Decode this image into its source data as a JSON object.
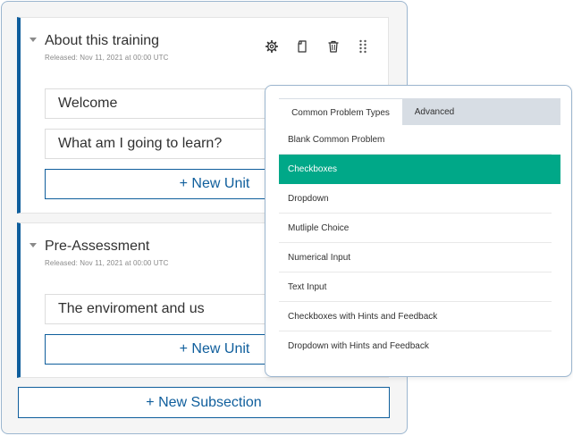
{
  "subsections": [
    {
      "title": "About this training",
      "meta": "Released: Nov 11, 2021 at 00:00 UTC",
      "units": [
        "Welcome",
        "What am I going to learn?"
      ],
      "new_unit_label": "+ New Unit"
    },
    {
      "title": "Pre-Assessment",
      "meta": "Released: Nov 11, 2021 at 00:00 UTC",
      "units": [
        "The enviroment and us"
      ],
      "new_unit_label": "+ New Unit"
    }
  ],
  "new_subsection_label": "+ New Subsection",
  "actions": {
    "icons": [
      "gear-icon",
      "document-icon",
      "trash-icon",
      "drag-handle-icon"
    ]
  },
  "problem_picker": {
    "tabs": [
      "Common Problem Types",
      "Advanced"
    ],
    "active_tab": "Common Problem Types",
    "items": [
      "Blank Common Problem",
      "Checkboxes",
      "Dropdown",
      "Mutliple Choice",
      "Numerical Input",
      "Text Input",
      "Checkboxes with Hints and Feedback",
      "Dropdown with Hints and Feedback"
    ],
    "selected_item": "Checkboxes"
  },
  "colors": {
    "brand": "#0f5e9c",
    "selected": "#00a888",
    "card_border": "#9cb6cf"
  }
}
